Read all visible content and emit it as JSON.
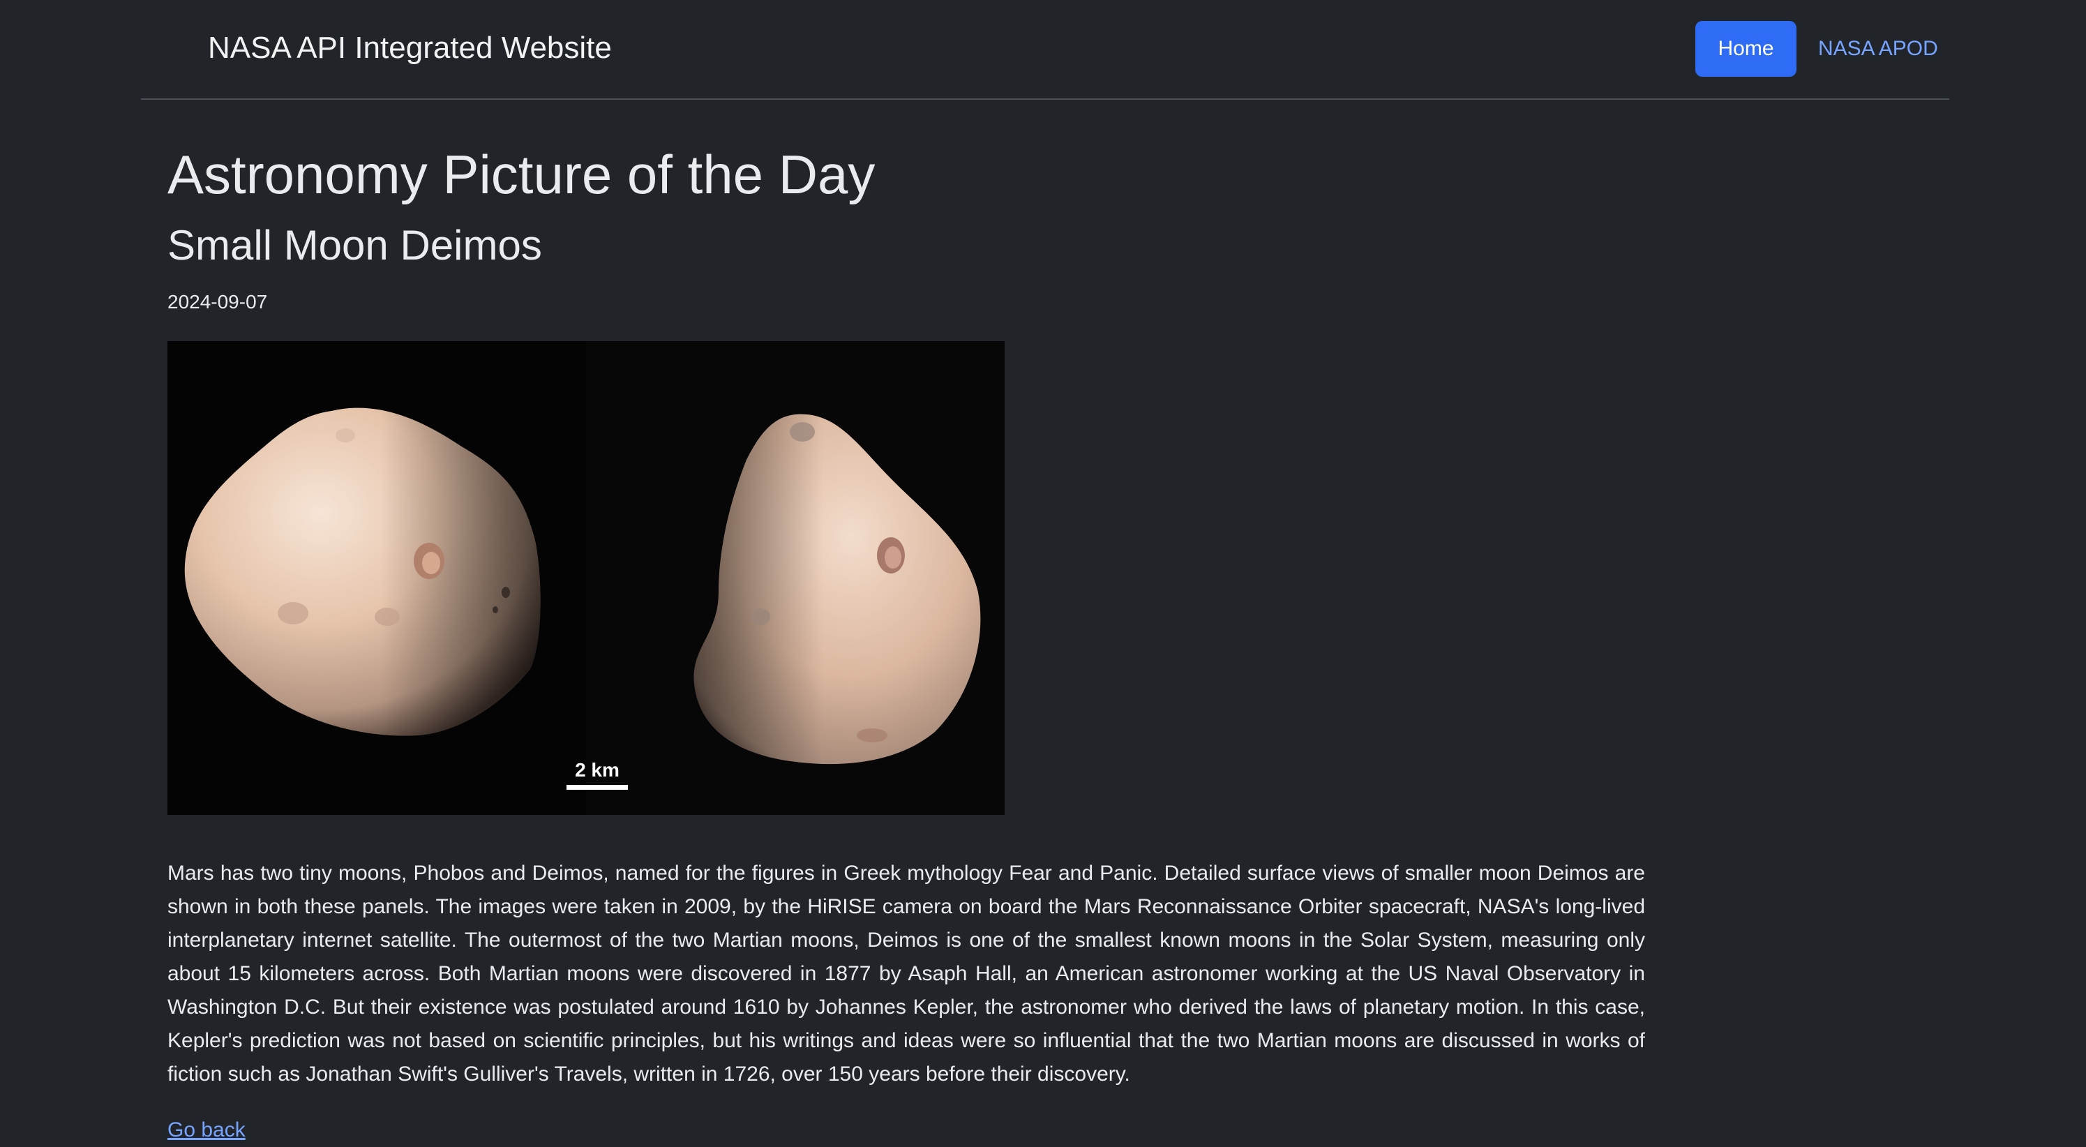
{
  "navbar": {
    "brand": "NASA API Integrated Website",
    "home_label": "Home",
    "apod_label": "NASA APOD"
  },
  "page": {
    "heading": "Astronomy Picture of the Day",
    "title": "Small Moon Deimos",
    "date": "2024-09-07",
    "image": {
      "scale_label": "2 km"
    },
    "description": "Mars has two tiny moons, Phobos and Deimos, named for the figures in Greek mythology Fear and Panic. Detailed surface views of smaller moon Deimos are shown in both these panels. The images were taken in 2009, by the HiRISE camera on board the Mars Reconnaissance Orbiter spacecraft, NASA's long-lived interplanetary internet satellite. The outermost of the two Martian moons, Deimos is one of the smallest known moons in the Solar System, measuring only about 15 kilometers across. Both Martian moons were discovered in 1877 by Asaph Hall, an American astronomer working at the US Naval Observatory in Washington D.C. But their existence was postulated around 1610 by Johannes Kepler, the astronomer who derived the laws of planetary motion. In this case, Kepler's prediction was not based on scientific principles, but his writings and ideas were so influential that the two Martian moons are discussed in works of fiction such as Jonathan Swift's Gulliver's Travels, written in 1726, over 150 years before their discovery.",
    "go_back_label": "Go back"
  },
  "colors": {
    "background": "#212529",
    "primary_button": "#2f6cf6",
    "link": "#76a4ff"
  }
}
